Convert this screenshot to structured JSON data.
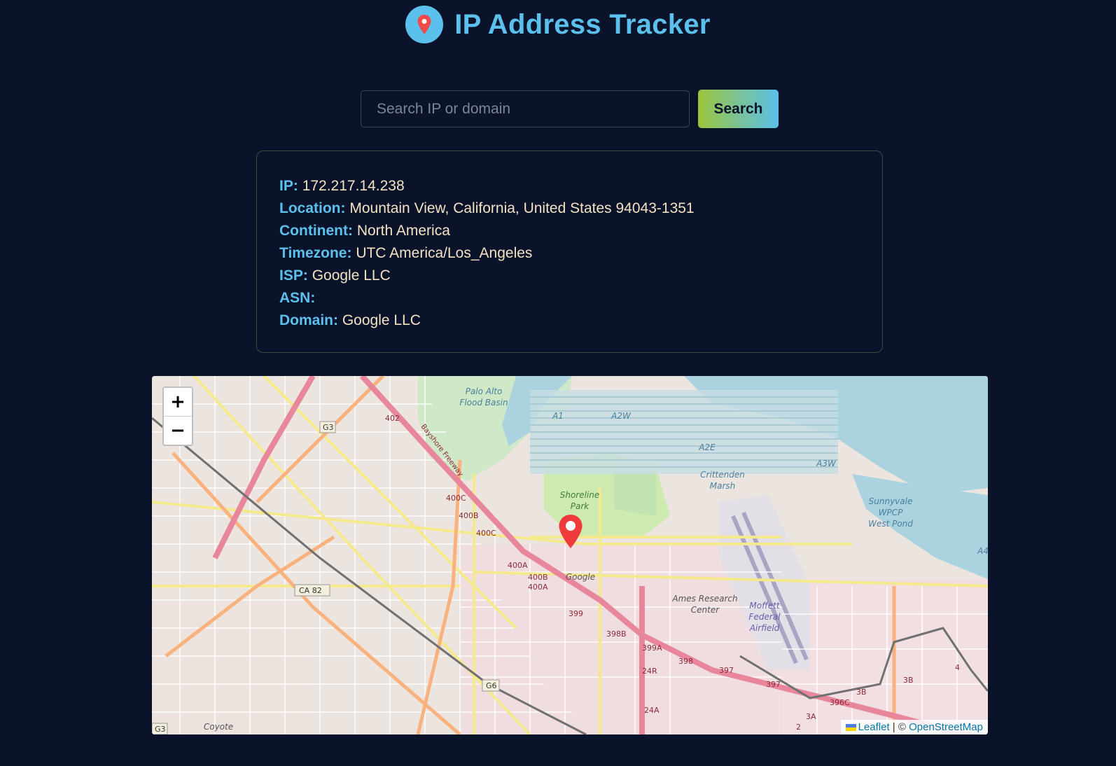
{
  "header": {
    "title": "IP Address Tracker",
    "logo_icon": "map-pin-icon"
  },
  "search": {
    "placeholder": "Search IP or domain",
    "value": "",
    "button_label": "Search"
  },
  "info": [
    {
      "label": "IP:",
      "value": "172.217.14.238"
    },
    {
      "label": "Location:",
      "value": "Mountain View, California, United States 94043-1351"
    },
    {
      "label": "Continent:",
      "value": "North America"
    },
    {
      "label": "Timezone:",
      "value": "UTC America/Los_Angeles"
    },
    {
      "label": "ISP:",
      "value": "Google LLC"
    },
    {
      "label": "ASN:",
      "value": ""
    },
    {
      "label": "Domain:",
      "value": "Google LLC"
    }
  ],
  "map": {
    "zoom_in_label": "+",
    "zoom_out_label": "−",
    "attribution_leaflet": "Leaflet",
    "attribution_separator": " | © ",
    "attribution_osm": "OpenStreetMap",
    "labels": {
      "palo_alto_1": "Palo Alto",
      "palo_alto_2": "Flood Basin",
      "shoreline_1": "Shoreline",
      "shoreline_2": "Park",
      "crittenden_1": "Crittenden",
      "crittenden_2": "Marsh",
      "sunnyvale_1": "Sunnyvale",
      "sunnyvale_2": "WPCP",
      "sunnyvale_3": "West Pond",
      "ames_1": "Ames Research",
      "ames_2": "Center",
      "moffett_1": "Moffett",
      "moffett_2": "Federal",
      "moffett_3": "Airfield",
      "google": "Google",
      "coyote": "Coyote",
      "bayshore": "Bayshore Freeway",
      "g3": "G3",
      "g3b": "G3",
      "g6": "G6",
      "ca82": "CA 82",
      "a1": "A1",
      "a2w": "A2W",
      "a2e": "A2E",
      "a3w": "A3W",
      "a4": "A4",
      "r402": "402",
      "r400c": "400C",
      "r400b": "400B",
      "r400c2": "400C",
      "r400a": "400A",
      "r400b2": "400B",
      "r400a2": "400A",
      "r399": "399",
      "r398b": "398B",
      "r399a": "399A",
      "r398": "398",
      "r397": "397",
      "r397b": "397",
      "r24r": "24R",
      "r24a": "24A",
      "r396c": "396C",
      "r3b": "3B",
      "r3b2": "3B",
      "r3a": "3A",
      "r4": "4",
      "r2": "2"
    }
  }
}
